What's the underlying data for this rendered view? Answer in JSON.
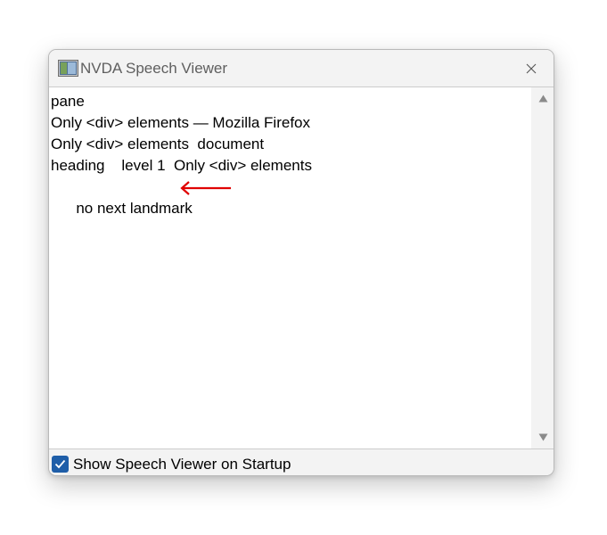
{
  "window": {
    "title": "NVDA Speech Viewer",
    "app_icon": "nvda-app-icon",
    "close_icon": "close-icon"
  },
  "speech_log": {
    "lines": [
      "pane",
      "Only <div> elements — Mozilla Firefox",
      "Only <div> elements  document",
      "heading    level 1  Only <div> elements",
      "no next landmark"
    ],
    "highlight_arrow_color": "#e00000"
  },
  "scrollbar": {
    "up_icon": "scroll-up-arrow-icon",
    "down_icon": "scroll-down-arrow-icon"
  },
  "footer": {
    "startup_checkbox_label": "Show Speech Viewer on Startup",
    "startup_checkbox_checked": true,
    "checkbox_color": "#1f5ea8"
  }
}
